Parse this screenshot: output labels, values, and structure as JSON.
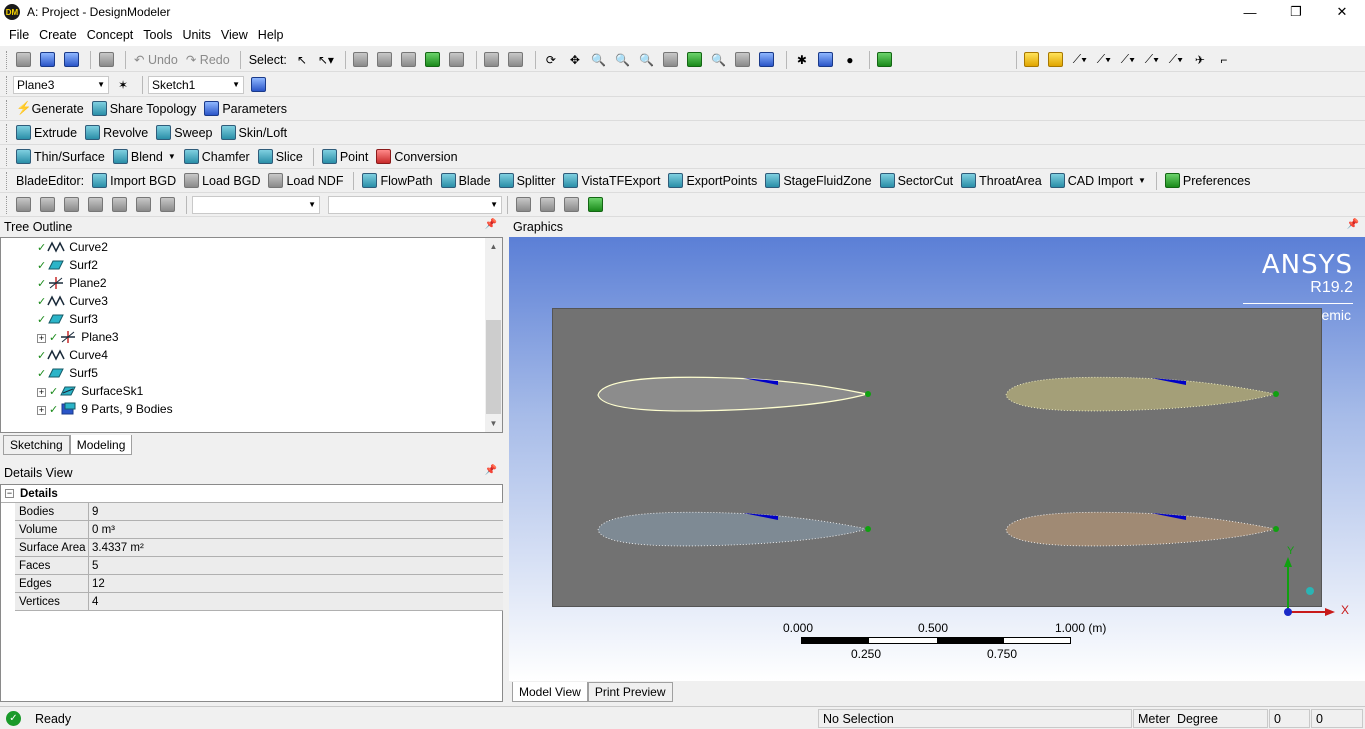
{
  "window": {
    "title": "A: Project - DesignModeler",
    "app_badge": "DM",
    "min": "—",
    "max": "❐",
    "close": "✕"
  },
  "menu": [
    "File",
    "Create",
    "Concept",
    "Tools",
    "Units",
    "View",
    "Help"
  ],
  "toolbar1": {
    "undo": "Undo",
    "redo": "Redo",
    "select": "Select:"
  },
  "toolbar2": {
    "plane": "Plane3",
    "sketch": "Sketch1"
  },
  "toolbar3": {
    "generate": "Generate",
    "share_topology": "Share Topology",
    "parameters": "Parameters"
  },
  "toolbar4": {
    "extrude": "Extrude",
    "revolve": "Revolve",
    "sweep": "Sweep",
    "skin_loft": "Skin/Loft"
  },
  "toolbar5": {
    "thin_surface": "Thin/Surface",
    "blend": "Blend",
    "chamfer": "Chamfer",
    "slice": "Slice",
    "point": "Point",
    "conversion": "Conversion"
  },
  "toolbar6": {
    "label": "BladeEditor:",
    "import_bgd": "Import BGD",
    "load_bgd": "Load BGD",
    "load_ndf": "Load NDF",
    "flowpath": "FlowPath",
    "blade": "Blade",
    "splitter": "Splitter",
    "vistatf": "VistaTFExport",
    "exportpoints": "ExportPoints",
    "stagefluid": "StageFluidZone",
    "sectorcut": "SectorCut",
    "throatarea": "ThroatArea",
    "cad_import": "CAD Import",
    "preferences": "Preferences"
  },
  "tree": {
    "header": "Tree Outline",
    "items": [
      {
        "label": "Curve2",
        "icon": "curve-icon"
      },
      {
        "label": "Surf2",
        "icon": "surface-icon"
      },
      {
        "label": "Plane2",
        "icon": "plane-icon"
      },
      {
        "label": "Curve3",
        "icon": "curve-icon"
      },
      {
        "label": "Surf3",
        "icon": "surface-icon"
      },
      {
        "label": "Plane3",
        "icon": "plane-icon",
        "expander": "+"
      },
      {
        "label": "Curve4",
        "icon": "curve-icon"
      },
      {
        "label": "Surf5",
        "icon": "surface-icon"
      },
      {
        "label": "SurfaceSk1",
        "icon": "surface-sketch-icon",
        "expander": "+"
      },
      {
        "label": "9 Parts, 9 Bodies",
        "icon": "parts-icon",
        "expander": "+"
      }
    ],
    "tabs": [
      "Sketching",
      "Modeling"
    ]
  },
  "details": {
    "header": "Details View",
    "section": "Details",
    "rows": [
      {
        "k": "Bodies",
        "v": "9"
      },
      {
        "k": "Volume",
        "v": "0 m³"
      },
      {
        "k": "Surface Area",
        "v": "3.4337 m²"
      },
      {
        "k": "Faces",
        "v": "5"
      },
      {
        "k": "Edges",
        "v": "12"
      },
      {
        "k": "Vertices",
        "v": "4"
      }
    ]
  },
  "graphics": {
    "header": "Graphics",
    "logo": "ANSYS",
    "version": "R19.2",
    "edition": "Academic",
    "scale_top": [
      "0.000",
      "0.500",
      "1.000 (m)"
    ],
    "scale_bottom": [
      "0.250",
      "0.750"
    ],
    "axis_y": "Y",
    "axis_x": "X",
    "tabs": [
      "Model View",
      "Print Preview"
    ],
    "colors": {
      "foil1": "#8c8c8c",
      "foil2": "#a49f78",
      "foil3": "#7e8a94",
      "foil4": "#a08a74",
      "frame": "#727272"
    }
  },
  "status": {
    "ready": "Ready",
    "selection": "No Selection",
    "units_len": "Meter",
    "units_ang": "Degree",
    "v1": "0",
    "v2": "0"
  }
}
